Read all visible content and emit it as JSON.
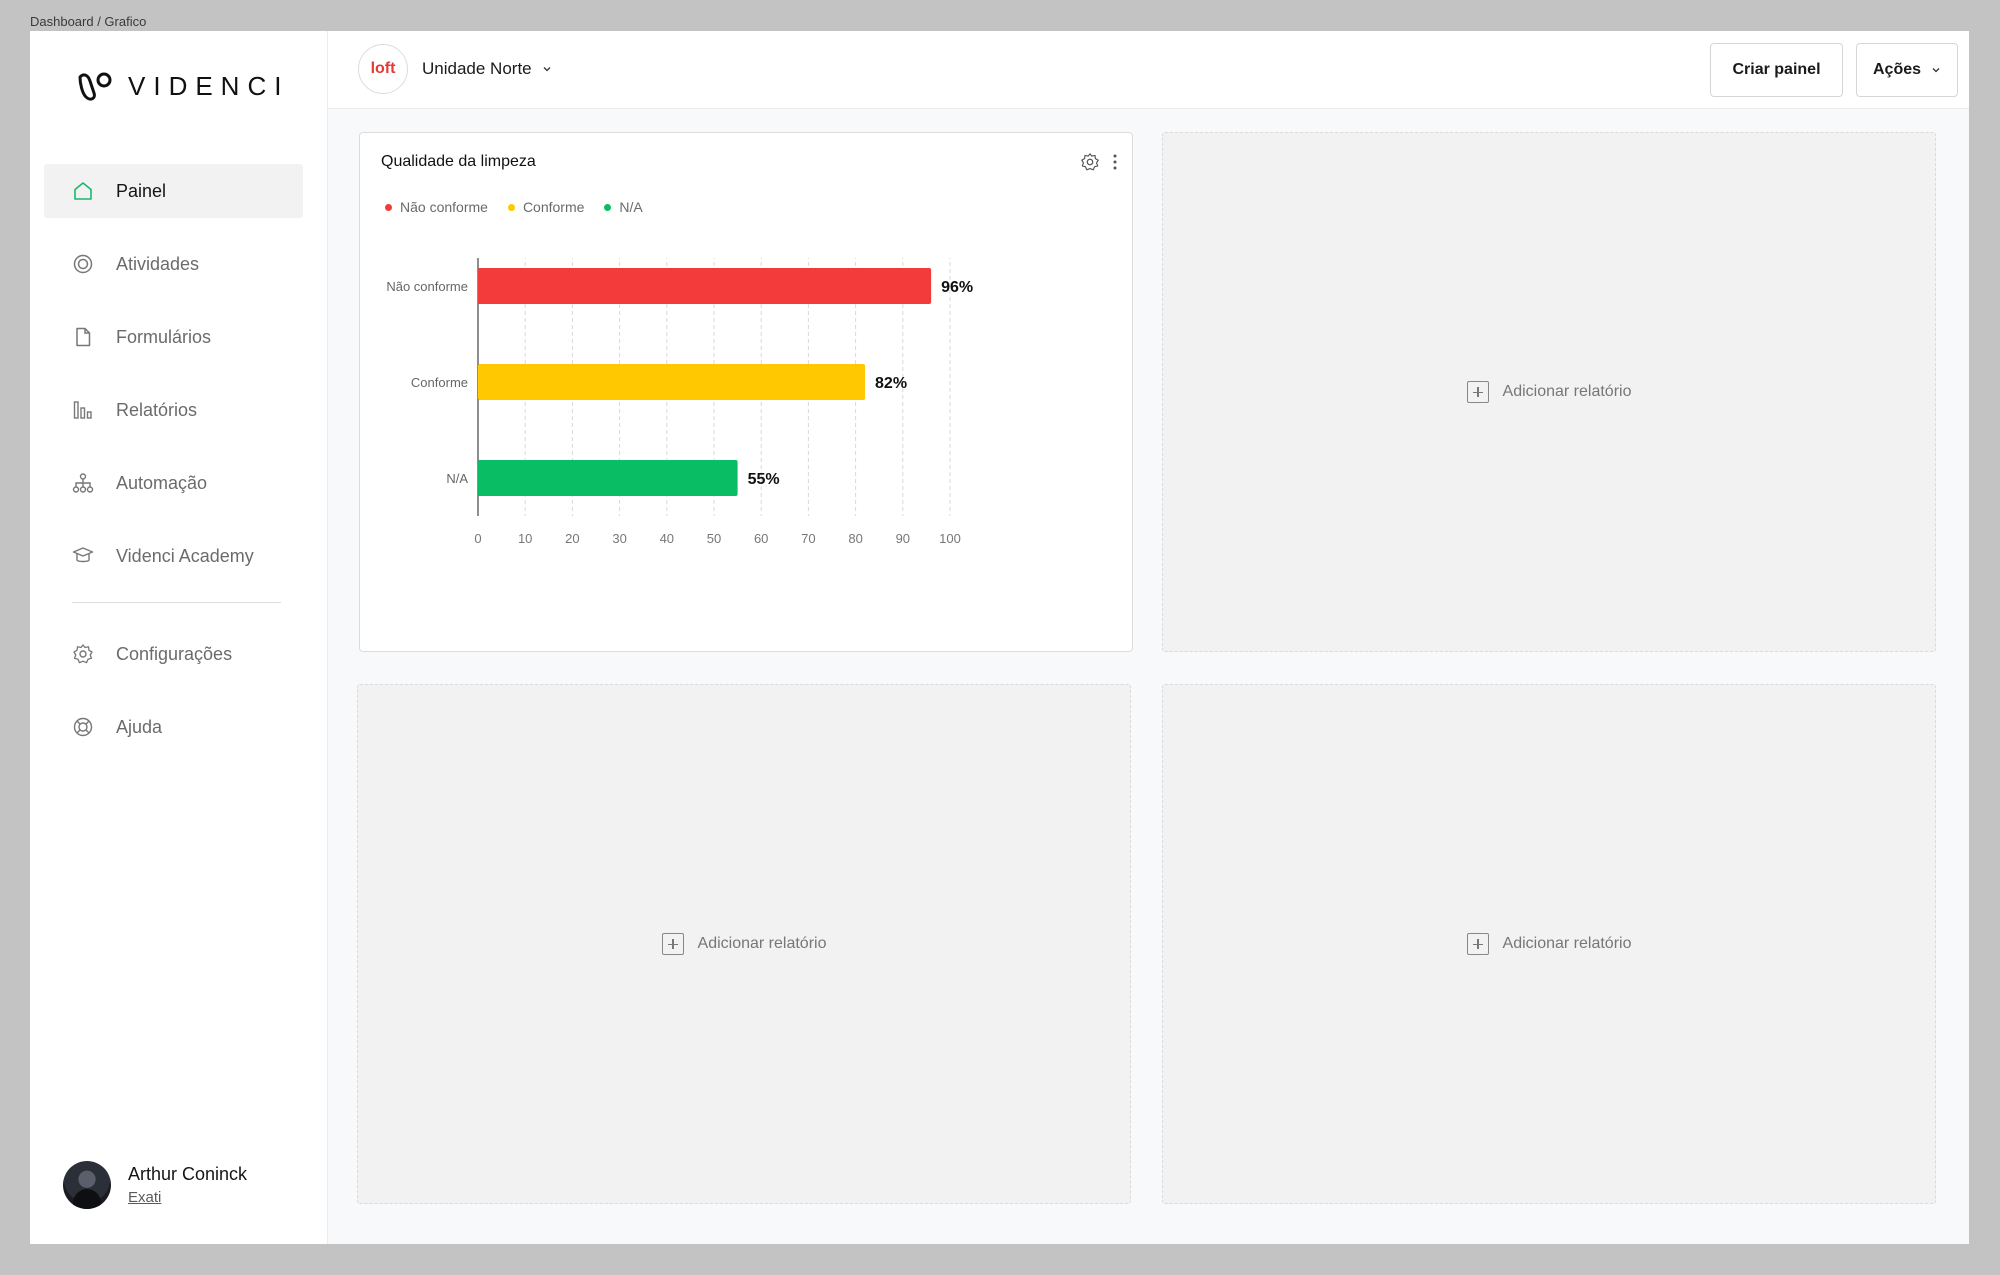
{
  "breadcrumb": "Dashboard / Grafico",
  "brand": {
    "name": "VIDENCI"
  },
  "sidebar": {
    "items": [
      {
        "label": "Painel",
        "icon": "home-icon",
        "active": true
      },
      {
        "label": "Atividades",
        "icon": "target-icon"
      },
      {
        "label": "Formulários",
        "icon": "document-icon"
      },
      {
        "label": "Relatórios",
        "icon": "bar-chart-icon"
      },
      {
        "label": "Automação",
        "icon": "hierarchy-icon"
      },
      {
        "label": "Videnci Academy",
        "icon": "graduation-cap-icon"
      }
    ],
    "footer_items": [
      {
        "label": "Configurações",
        "icon": "gear-icon"
      },
      {
        "label": "Ajuda",
        "icon": "lifebuoy-icon"
      }
    ]
  },
  "user": {
    "name": "Arthur Coninck",
    "org": "Exati"
  },
  "topbar": {
    "unit_logo": "loft",
    "unit_name": "Unidade Norte",
    "create_label": "Criar painel",
    "actions_label": "Ações"
  },
  "card": {
    "title": "Qualidade da limpeza",
    "legend": [
      {
        "label": "Não conforme",
        "color": "#f43b3b"
      },
      {
        "label": "Conforme",
        "color": "#ffc800"
      },
      {
        "label": "N/A",
        "color": "#08bd63"
      }
    ]
  },
  "empty_cards": {
    "add_label": "Adicionar relatório"
  },
  "chart_data": {
    "type": "bar",
    "orientation": "horizontal",
    "title": "Qualidade da limpeza",
    "categories": [
      "Não conforme",
      "Conforme",
      "N/A"
    ],
    "values": [
      96,
      82,
      55
    ],
    "value_labels": [
      "96%",
      "82%",
      "55%"
    ],
    "colors": [
      "#f43b3b",
      "#ffc800",
      "#08bd63"
    ],
    "xlim": [
      0,
      100
    ],
    "xticks": [
      0,
      10,
      20,
      30,
      40,
      50,
      60,
      70,
      80,
      90,
      100
    ],
    "grid": true,
    "legend_position": "top-left"
  }
}
